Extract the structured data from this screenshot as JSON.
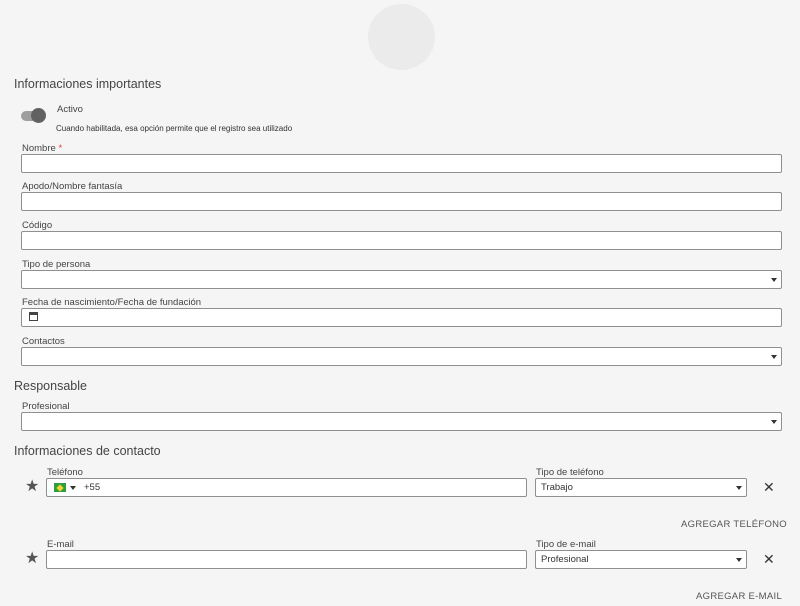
{
  "section_important": "Informaciones importantes",
  "active": {
    "label": "Activo",
    "help": "Cuando habilitada, esa opción permite que el registro sea utilizado",
    "on": true
  },
  "fields": {
    "nombre": {
      "label": "Nombre",
      "required": "*",
      "value": ""
    },
    "apodo": {
      "label": "Apodo/Nombre fantasía",
      "value": ""
    },
    "codigo": {
      "label": "Código",
      "value": ""
    },
    "tipo_persona": {
      "label": "Tipo de persona",
      "value": ""
    },
    "fecha": {
      "label": "Fecha de nascimiento/Fecha de fundación",
      "value": ""
    },
    "contactos": {
      "label": "Contactos",
      "value": ""
    }
  },
  "section_responsable": "Responsable",
  "profesional": {
    "label": "Profesional",
    "value": ""
  },
  "section_contacto": "Informaciones de contacto",
  "phone": {
    "label": "Teléfono",
    "value": "+55",
    "country_icon": "brazil-flag-icon",
    "type_label": "Tipo de teléfono",
    "type_value": "Trabajo",
    "add_label": "AGREGAR TELÉFONO"
  },
  "email": {
    "label": "E-mail",
    "value": "",
    "type_label": "Tipo de e-mail",
    "type_value": "Profesional",
    "add_label": "AGREGAR E-MAIL"
  },
  "icons": {
    "star": "star-icon",
    "remove": "close-icon",
    "calendar": "calendar-icon",
    "dropdown": "chevron-down-icon"
  },
  "colors": {
    "background": "#f5f5f5",
    "required": "#e53935",
    "toggle_knob": "#616161",
    "toggle_track": "#9e9e9e"
  }
}
